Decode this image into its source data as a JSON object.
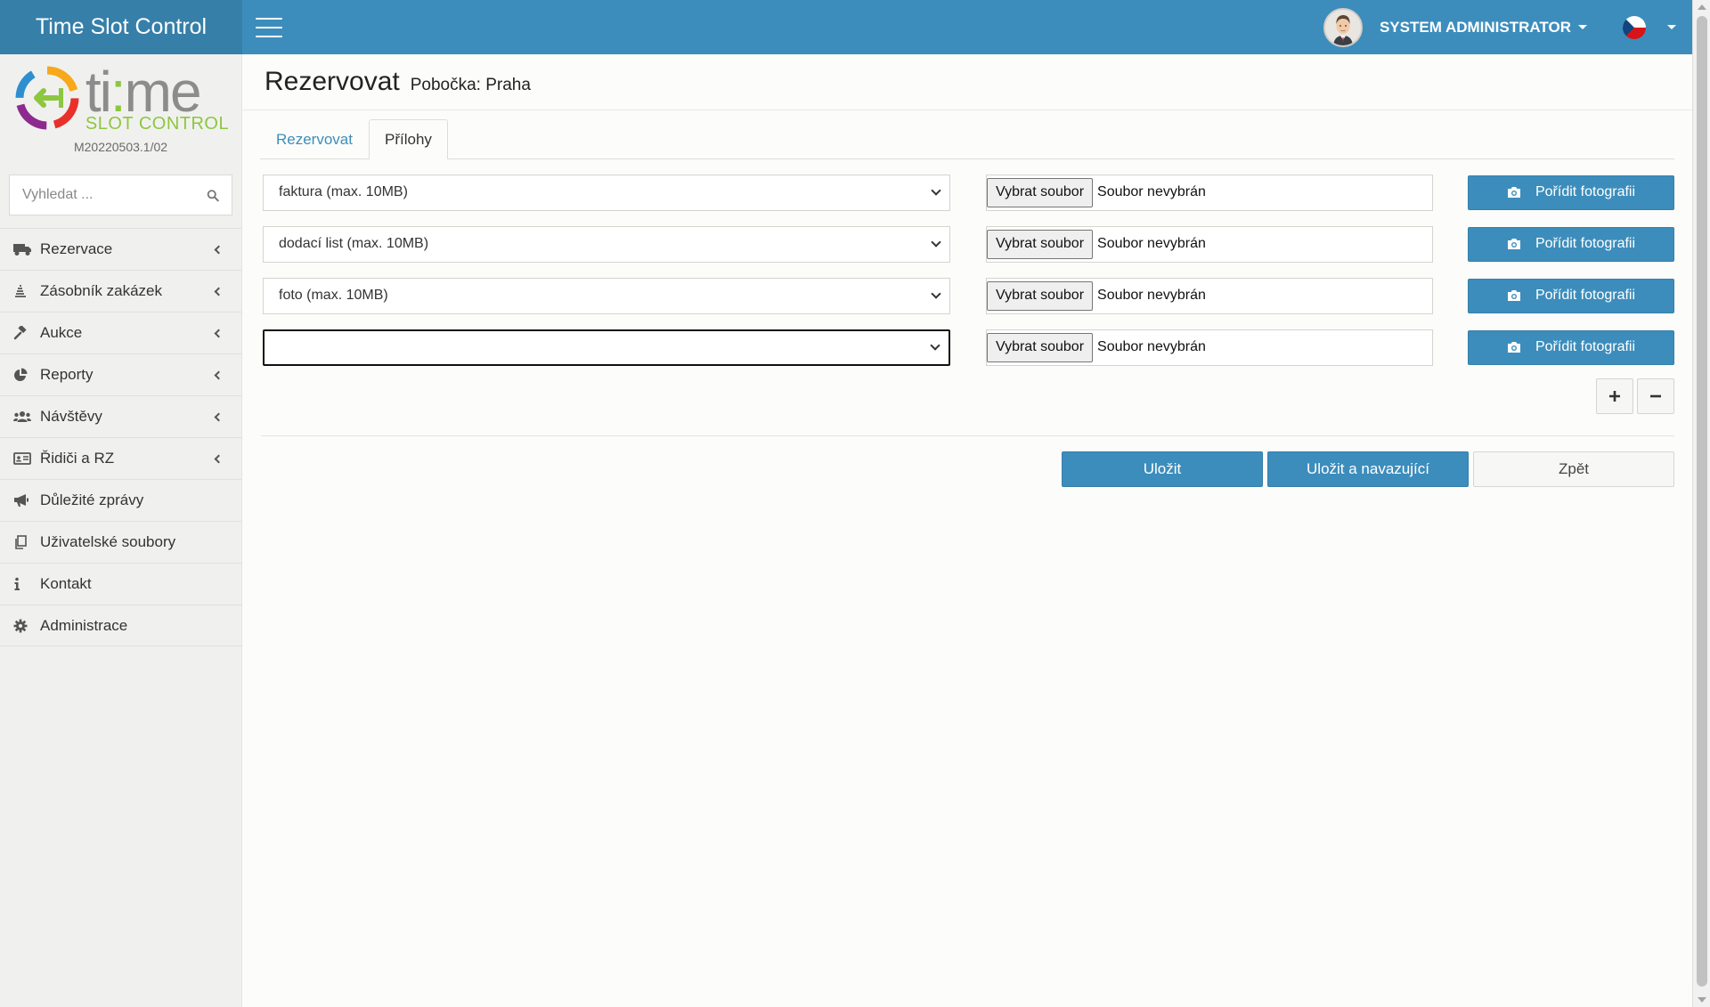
{
  "app": {
    "title": "Time Slot Control"
  },
  "header": {
    "user_name": "SYSTEM ADMINISTRATOR",
    "language": "CZ"
  },
  "logo": {
    "text_ti": "ti",
    "text_colon": ":",
    "text_me": "me",
    "text_sub": "SLOT CONTROL"
  },
  "sidebar": {
    "version": "M20220503.1/02",
    "search_placeholder": "Vyhledat ...",
    "items": [
      {
        "label": "Rezervace",
        "icon": "truck-icon",
        "has_submenu": true
      },
      {
        "label": "Zásobník zakázek",
        "icon": "stack-icon",
        "has_submenu": true
      },
      {
        "label": "Aukce",
        "icon": "gavel-icon",
        "has_submenu": true
      },
      {
        "label": "Reporty",
        "icon": "pie-chart-icon",
        "has_submenu": true
      },
      {
        "label": "Návštěvy",
        "icon": "users-icon",
        "has_submenu": true
      },
      {
        "label": "Řidiči a RZ",
        "icon": "id-card-icon",
        "has_submenu": true
      },
      {
        "label": "Důležité zprávy",
        "icon": "bullhorn-icon",
        "has_submenu": false
      },
      {
        "label": "Uživatelské soubory",
        "icon": "files-icon",
        "has_submenu": false
      },
      {
        "label": "Kontakt",
        "icon": "info-icon",
        "has_submenu": false
      },
      {
        "label": "Administrace",
        "icon": "gear-icon",
        "has_submenu": false
      }
    ]
  },
  "page": {
    "title": "Rezervovat",
    "subtitle": "Pobočka: Praha",
    "tabs": [
      {
        "label": "Rezervovat",
        "active": false
      },
      {
        "label": "Přílohy",
        "active": true
      }
    ]
  },
  "attachments": {
    "file_button_label": "Vybrat soubor",
    "file_status": "Soubor nevybrán",
    "photo_button_label": "Pořídit fotografii",
    "rows": [
      {
        "type": "faktura (max. 10MB)"
      },
      {
        "type": "dodací list (max. 10MB)"
      },
      {
        "type": "foto (max. 10MB)"
      },
      {
        "type": ""
      }
    ]
  },
  "actions": {
    "save": "Uložit",
    "save_continue": "Uložit a navazující",
    "back": "Zpět"
  },
  "colors": {
    "primary": "#3c8dbc",
    "brand_dark": "#367fa9",
    "logo_green": "#8dc63f"
  }
}
